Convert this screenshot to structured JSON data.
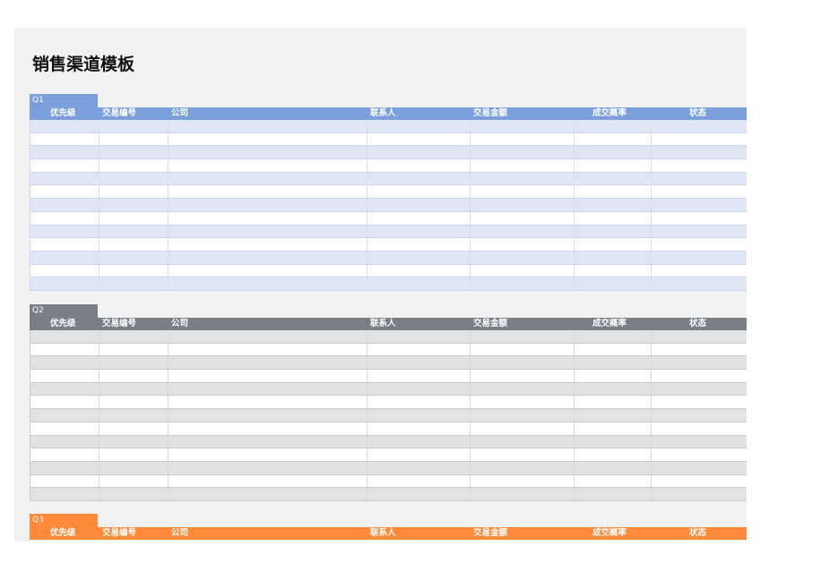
{
  "title": "销售渠道模板",
  "columns": [
    "优先级",
    "交易编号",
    "公司",
    "联系人",
    "交易金额",
    "成交概率",
    "状态"
  ],
  "sections": [
    {
      "label": "Q1",
      "color": "#7b9fdb",
      "rows": 13
    },
    {
      "label": "Q2",
      "color": "#7a7e86",
      "rows": 13
    },
    {
      "label": "Q3",
      "color": "#ff8a3a",
      "rows": 0
    }
  ]
}
